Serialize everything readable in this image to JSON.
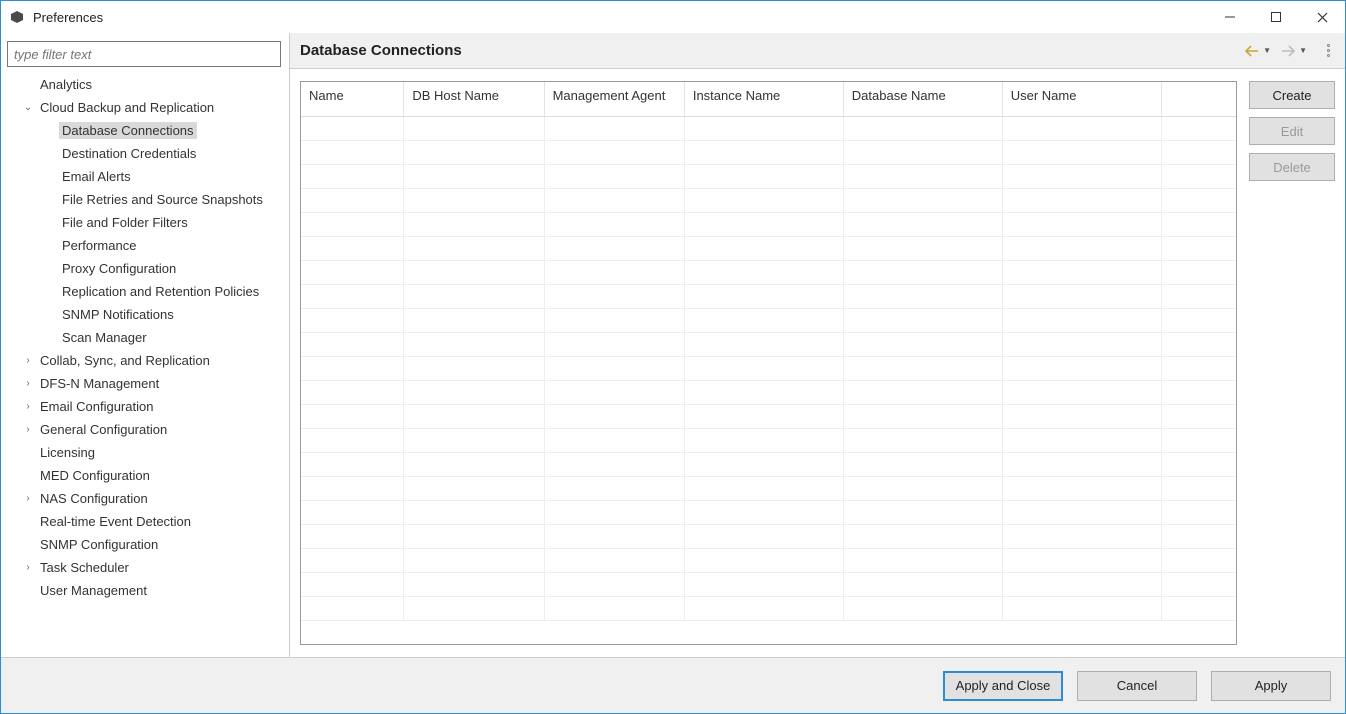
{
  "window": {
    "title": "Preferences"
  },
  "filter": {
    "placeholder": "type filter text"
  },
  "tree": [
    {
      "label": "Analytics",
      "depth": 1,
      "expandable": false
    },
    {
      "label": "Cloud Backup and Replication",
      "depth": 1,
      "expandable": true,
      "expanded": true
    },
    {
      "label": "Database Connections",
      "depth": 2,
      "selected": true
    },
    {
      "label": "Destination Credentials",
      "depth": 2
    },
    {
      "label": "Email Alerts",
      "depth": 2
    },
    {
      "label": "File Retries and Source Snapshots",
      "depth": 2
    },
    {
      "label": "File and Folder Filters",
      "depth": 2
    },
    {
      "label": "Performance",
      "depth": 2
    },
    {
      "label": "Proxy Configuration",
      "depth": 2
    },
    {
      "label": "Replication and Retention Policies",
      "depth": 2
    },
    {
      "label": "SNMP Notifications",
      "depth": 2
    },
    {
      "label": "Scan Manager",
      "depth": 2
    },
    {
      "label": "Collab, Sync, and Replication",
      "depth": 1,
      "expandable": true
    },
    {
      "label": "DFS-N Management",
      "depth": 1,
      "expandable": true
    },
    {
      "label": "Email Configuration",
      "depth": 1,
      "expandable": true
    },
    {
      "label": "General Configuration",
      "depth": 1,
      "expandable": true
    },
    {
      "label": "Licensing",
      "depth": 1,
      "expandable": false
    },
    {
      "label": "MED Configuration",
      "depth": 1,
      "expandable": false
    },
    {
      "label": "NAS Configuration",
      "depth": 1,
      "expandable": true
    },
    {
      "label": "Real-time Event Detection",
      "depth": 1,
      "expandable": false
    },
    {
      "label": "SNMP Configuration",
      "depth": 1,
      "expandable": false
    },
    {
      "label": "Task Scheduler",
      "depth": 1,
      "expandable": true
    },
    {
      "label": "User Management",
      "depth": 1,
      "expandable": false
    }
  ],
  "page": {
    "title": "Database Connections"
  },
  "table": {
    "columns": [
      "Name",
      "DB Host Name",
      "Management Agent",
      "Instance Name",
      "Database Name",
      "User Name",
      ""
    ],
    "empty_rows": 21
  },
  "side_buttons": {
    "create": "Create",
    "edit": "Edit",
    "delete": "Delete"
  },
  "footer": {
    "apply_close": "Apply and Close",
    "cancel": "Cancel",
    "apply": "Apply"
  }
}
